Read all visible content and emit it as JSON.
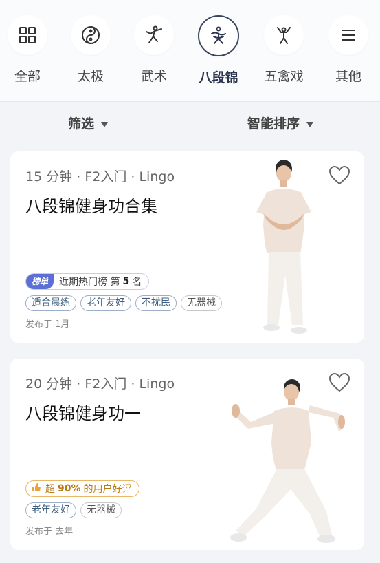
{
  "categories": [
    {
      "label": "全部",
      "icon": "grid-icon"
    },
    {
      "label": "太极",
      "icon": "taiji-icon"
    },
    {
      "label": "武术",
      "icon": "martial-arts-icon"
    },
    {
      "label": "八段锦",
      "icon": "baduanjin-icon",
      "active": true
    },
    {
      "label": "五禽戏",
      "icon": "wuqinxi-icon"
    },
    {
      "label": "其他",
      "icon": "menu-icon"
    }
  ],
  "filters": {
    "filter_label": "筛选",
    "sort_label": "智能排序"
  },
  "cards": [
    {
      "meta": "15 分钟 · F2入门 · Lingo",
      "title": "八段锦健身功合集",
      "rank": {
        "tag": "榜单",
        "text_before": "近期热门榜 第",
        "number": "5",
        "text_after": "名"
      },
      "tags": [
        "适合晨练",
        "老年友好",
        "不扰民",
        "无器械"
      ],
      "date": "发布于 1月"
    },
    {
      "meta": "20 分钟 · F2入门 · Lingo",
      "title": "八段锦健身功一",
      "praise": {
        "prefix": "超",
        "percent": "90%",
        "suffix": "的用户好评"
      },
      "tags": [
        "老年友好",
        "无器械"
      ],
      "date": "发布于 去年"
    }
  ],
  "colors": {
    "accent": "#2b3550",
    "rank_tag": "#5b6fd6",
    "praise": "#e8a33a"
  }
}
